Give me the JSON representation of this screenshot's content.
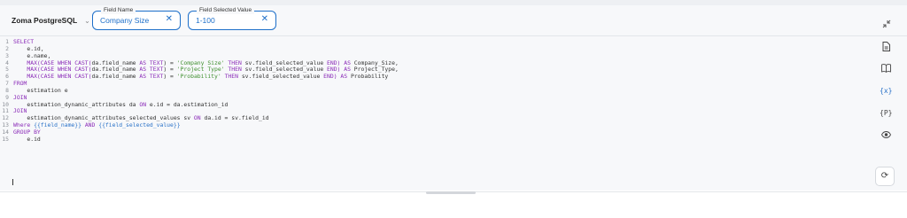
{
  "toolbar": {
    "db_label": "Zoma PostgreSQL",
    "field_name": {
      "legend": "Field Name",
      "value": "Company Size"
    },
    "field_value": {
      "legend": "Field Selected Value",
      "value": "1-100"
    }
  },
  "editor": {
    "line_numbers": [
      "1",
      "2",
      "3",
      "4",
      "5",
      "6",
      "7",
      "8",
      "9",
      "10",
      "11",
      "12",
      "13",
      "14",
      "15"
    ],
    "cursor_line": 14
  },
  "icons": {
    "db_chevron": "chevron-down-icon",
    "clear": "close-icon",
    "collapse": "collapse-icon",
    "side": [
      "document-icon",
      "book-icon",
      "variable-icon",
      "parameter-icon",
      "eye-icon"
    ],
    "refresh": "refresh-icon"
  },
  "colors": {
    "accent": "#1d6fc9",
    "keyword": "#8a2ab8",
    "string": "#3f8f2e",
    "template": "#2a72c8"
  }
}
